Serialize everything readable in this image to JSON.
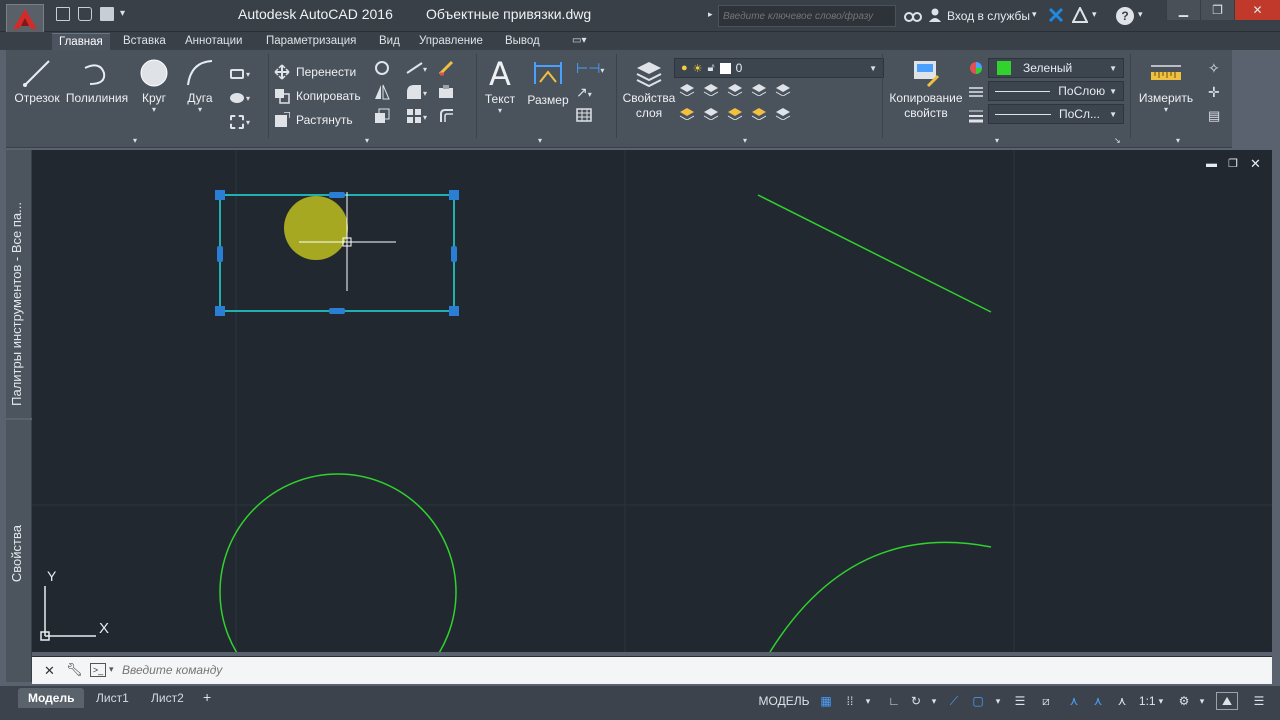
{
  "title": {
    "app": "Autodesk AutoCAD 2016",
    "file": "Объектные привязки.dwg",
    "search_placeholder": "Введите ключевое слово/фразу",
    "signin": "Вход в службы"
  },
  "tabs": [
    "Главная",
    "Вставка",
    "Аннотации",
    "Параметризация",
    "Вид",
    "Управление",
    "Вывод"
  ],
  "ribbon": {
    "draw": {
      "line": "Отрезок",
      "polyline": "Полилиния",
      "circle": "Круг",
      "arc": "Дуга"
    },
    "modify": {
      "move": "Перенести",
      "copy": "Копировать",
      "stretch": "Растянуть"
    },
    "annotation": {
      "text": "Текст",
      "dimension": "Размер"
    },
    "layers": {
      "properties_line1": "Свойства",
      "properties_line2": "слоя",
      "current_layer": "0"
    },
    "properties": {
      "match_line1": "Копирование",
      "match_line2": "свойств",
      "color": "Зеленый",
      "linetype": "ПоСлою",
      "lineweight": "ПоСл..."
    },
    "utilities": {
      "measure": "Измерить"
    }
  },
  "colors": {
    "accent_green": "#31d12e",
    "drawing_bg": "#212830",
    "selection": "#2a7fd4",
    "highlight": "#c8c81e"
  },
  "palettes": {
    "tool_palettes": "Палитры инструментов - Все па...",
    "properties": "Свойства"
  },
  "ucs": {
    "x": "X",
    "y": "Y"
  },
  "command": {
    "placeholder": "Введите команду"
  },
  "status": {
    "layout_tabs": [
      "Модель",
      "Лист1",
      "Лист2"
    ],
    "model_label": "МОДЕЛЬ",
    "scale": "1:1"
  }
}
